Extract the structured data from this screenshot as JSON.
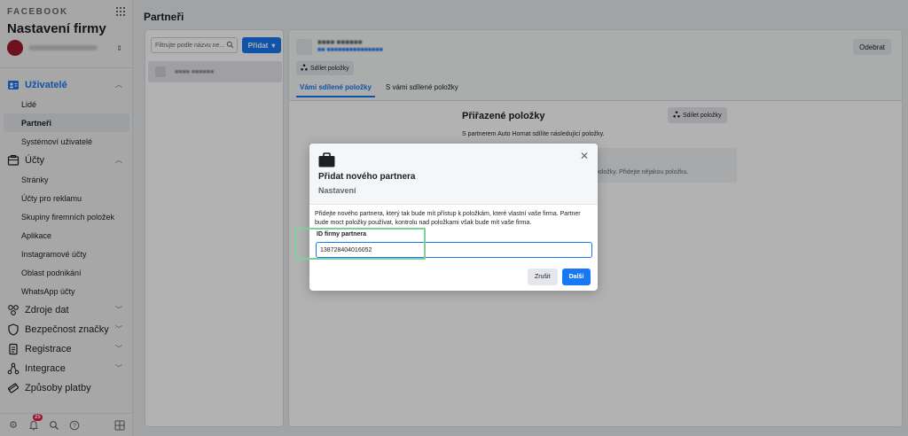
{
  "sidebar": {
    "brand": "FACEBOOK",
    "title": "Nastavení firmy",
    "sections": [
      {
        "label": "Uživatelé",
        "icon": "users-icon"
      },
      {
        "label": "Účty",
        "icon": "accounts-icon"
      },
      {
        "label": "Zdroje dat",
        "icon": "data-sources-icon"
      },
      {
        "label": "Bezpečnost značky",
        "icon": "shield-icon"
      },
      {
        "label": "Registrace",
        "icon": "registration-icon"
      },
      {
        "label": "Integrace",
        "icon": "integrations-icon"
      },
      {
        "label": "Způsoby platby",
        "icon": "payment-icon"
      }
    ],
    "users_items": [
      "Lidé",
      "Partneři",
      "Systémoví uživatelé"
    ],
    "accounts_items": [
      "Stránky",
      "Účty pro reklamu",
      "Skupiny firemních položek",
      "Aplikace",
      "Instagramové účty",
      "Oblast podnikání",
      "WhatsApp účty"
    ],
    "notification_count": "25"
  },
  "main": {
    "page_title": "Partneři",
    "search_placeholder": "Filtrujte podle názvu ne...",
    "add_button": "Přidat",
    "remove_button": "Odebrat",
    "share_button": "Sdílet položky",
    "tabs": [
      "Vámi sdílené položky",
      "S vámi sdílené položky"
    ],
    "assigned_title": "Přiřazené položky",
    "assigned_desc": "S partnerem Auto Hornat sdílíte následující položky.",
    "empty_text": "položky. Přidejte nějakou položku."
  },
  "modal": {
    "title": "Přidat nového partnera",
    "subtitle": "Nastavení",
    "description": "Přidejte nového partnera, který tak bude mít přístup k položkám, které vlastní vaše firma. Partner bude moct položky používat, kontrolu nad položkami však bude mít vaše firma.",
    "field_label": "ID firmy partnera",
    "field_value": "138728404016052",
    "cancel": "Zrušit",
    "next": "Další"
  }
}
